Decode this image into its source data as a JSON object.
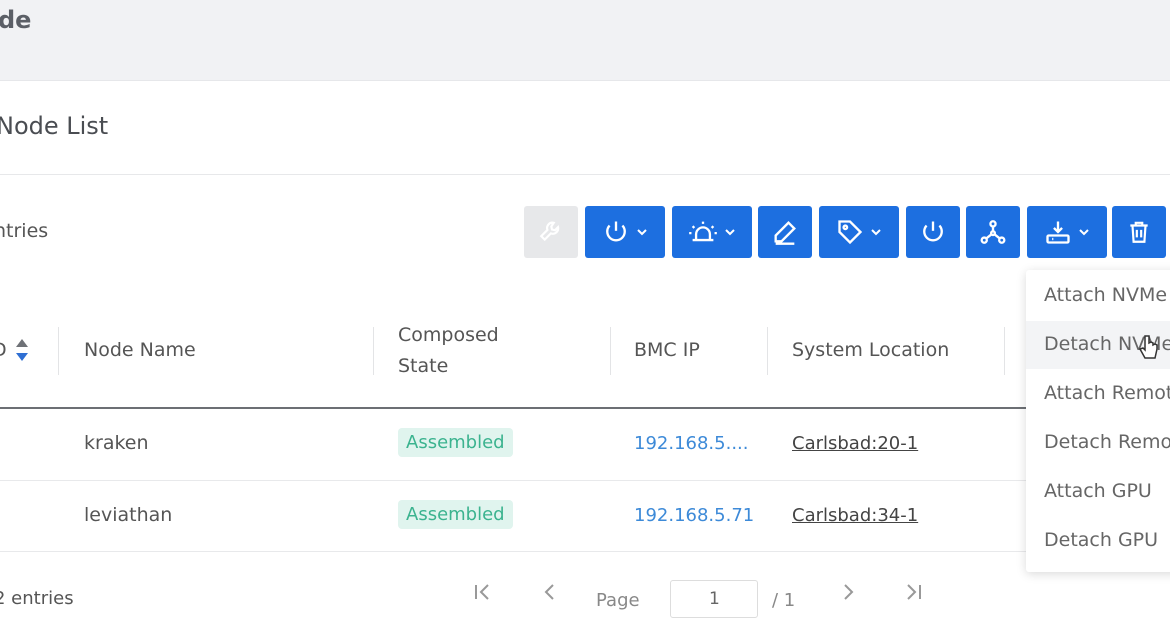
{
  "header": {
    "title": "de"
  },
  "panel": {
    "title": "Node List",
    "entries_label": "ntries"
  },
  "toolbar": {
    "buttons": [
      {
        "name": "wrench",
        "disabled": true
      },
      {
        "name": "power-dropdown"
      },
      {
        "name": "indicator-dropdown"
      },
      {
        "name": "edit"
      },
      {
        "name": "tag-dropdown"
      },
      {
        "name": "power"
      },
      {
        "name": "compose"
      },
      {
        "name": "attach-dropdown"
      },
      {
        "name": "delete"
      }
    ]
  },
  "table": {
    "sort_col_label": "D",
    "headers": {
      "node_name": "Node Name",
      "composed_state_1": "Composed",
      "composed_state_2": "State",
      "bmc_ip": "BMC IP",
      "system_location": "System Location"
    },
    "rows": [
      {
        "name": "kraken",
        "state": "Assembled",
        "ip": "192.168.5....",
        "location": "Carlsbad:20-1"
      },
      {
        "name": "leviathan",
        "state": "Assembled",
        "ip": "192.168.5.71",
        "location": "Carlsbad:34-1"
      }
    ]
  },
  "dropdown": {
    "items": [
      {
        "label": "Attach NVMe"
      },
      {
        "label": "Detach NVMe"
      },
      {
        "label": "Attach Remote"
      },
      {
        "label": "Detach Remote"
      },
      {
        "label": "Attach GPU"
      },
      {
        "label": "Detach GPU"
      }
    ]
  },
  "footer": {
    "entries": "2 entries",
    "page_label": "Page",
    "page_value": "1",
    "page_total": "/ 1"
  },
  "colors": {
    "primary": "#1d6fe0",
    "badge_bg": "#e0f4ee",
    "badge_text": "#3bb38f",
    "link": "#3d8ad8"
  }
}
